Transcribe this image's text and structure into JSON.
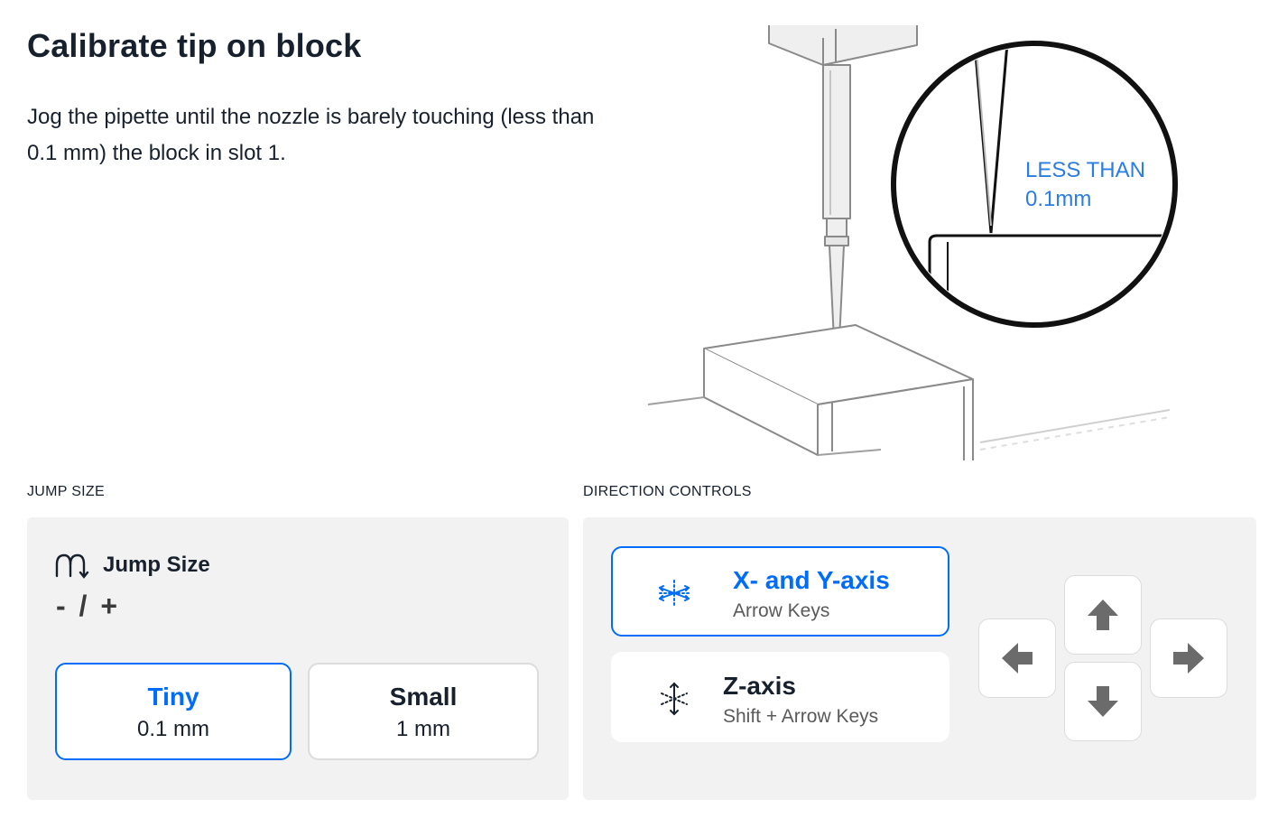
{
  "header": {
    "title": "Calibrate tip on block",
    "description": "Jog the pipette until the nozzle is barely touching (less than 0.1 mm) the block in slot 1."
  },
  "illustration": {
    "callout_line1": "LESS THAN",
    "callout_line2": "0.1mm",
    "callout_color": "#2a7de1"
  },
  "jump_size": {
    "section_label": "JUMP SIZE",
    "heading": "Jump Size",
    "shortcut": "- / +",
    "icon": "jump-size-icon",
    "options": [
      {
        "name": "Tiny",
        "value": "0.1 mm",
        "selected": true
      },
      {
        "name": "Small",
        "value": "1 mm",
        "selected": false
      }
    ]
  },
  "direction_controls": {
    "section_label": "DIRECTION CONTROLS",
    "axes": [
      {
        "name": "X- and Y-axis",
        "keys": "Arrow Keys",
        "icon": "xy-axis-icon",
        "selected": true
      },
      {
        "name": "Z-axis",
        "keys": "Shift + Arrow Keys",
        "icon": "z-axis-icon",
        "selected": false
      }
    ],
    "arrow_keys": [
      "arrow-up-icon",
      "arrow-left-icon",
      "arrow-down-icon",
      "arrow-right-icon"
    ]
  },
  "colors": {
    "accent": "#006cfa",
    "text": "#16212d",
    "panel_bg": "#f2f2f2",
    "arrow": "#6b6b6b"
  }
}
